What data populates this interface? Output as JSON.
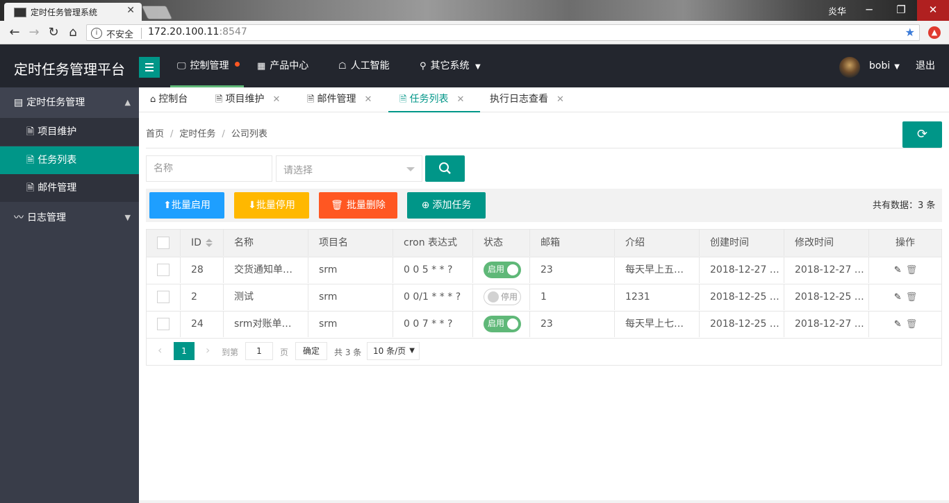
{
  "browser": {
    "tab_title": "定时任务管理系统",
    "user_chip": "炎华",
    "insecure_label": "不安全",
    "url_host": "172.20.100.11",
    "url_port": ":8547"
  },
  "header": {
    "app_title": "定时任务管理平台",
    "nav": [
      {
        "label": "控制管理",
        "icon": "monitor-icon"
      },
      {
        "label": "产品中心",
        "icon": "apps-icon"
      },
      {
        "label": "人工智能",
        "icon": "robot-icon"
      },
      {
        "label": "其它系统",
        "icon": "location-icon"
      }
    ],
    "username": "bobi",
    "logout": "退出"
  },
  "sidebar": {
    "groups": [
      {
        "label": "定时任务管理",
        "items": [
          "项目维护",
          "任务列表",
          "邮件管理"
        ]
      },
      {
        "label": "日志管理"
      }
    ]
  },
  "tabs": [
    {
      "label": "控制台"
    },
    {
      "label": "项目维护"
    },
    {
      "label": "邮件管理"
    },
    {
      "label": "任务列表"
    },
    {
      "label": "执行日志查看"
    }
  ],
  "breadcrumb": [
    "首页",
    "定时任务",
    "公司列表"
  ],
  "filters": {
    "name_placeholder": "名称",
    "select_placeholder": "请选择"
  },
  "toolbar": {
    "enable": "批量启用",
    "disable": "批量停用",
    "delete": "批量删除",
    "add": "添加任务",
    "total": "共有数据：3 条"
  },
  "table": {
    "columns": [
      "ID",
      "名称",
      "项目名",
      "cron 表达式",
      "状态",
      "邮箱",
      "介绍",
      "创建时间",
      "修改时间",
      "操作"
    ],
    "rows": [
      {
        "id": "28",
        "name": "交货通知单…",
        "project": "srm",
        "cron": "0 0 5 * * ?",
        "status": "启用",
        "status_on": true,
        "mail": "23",
        "intro": "每天早上五…",
        "created": "2018-12-27 …",
        "modified": "2018-12-27 …"
      },
      {
        "id": "2",
        "name": "测试",
        "project": "srm",
        "cron": "0 0/1 * * * ?",
        "status": "停用",
        "status_on": false,
        "mail": "1",
        "intro": "1231",
        "created": "2018-12-25 …",
        "modified": "2018-12-25 …"
      },
      {
        "id": "24",
        "name": "srm对账单…",
        "project": "srm",
        "cron": "0 0 7 * * ?",
        "status": "启用",
        "status_on": true,
        "mail": "23",
        "intro": "每天早上七…",
        "created": "2018-12-25 …",
        "modified": "2018-12-27 …"
      }
    ]
  },
  "pagination": {
    "current": "1",
    "goto_label": "到第",
    "page_value": "1",
    "page_unit": "页",
    "confirm": "确定",
    "total": "共 3 条",
    "page_size": "10 条/页"
  }
}
